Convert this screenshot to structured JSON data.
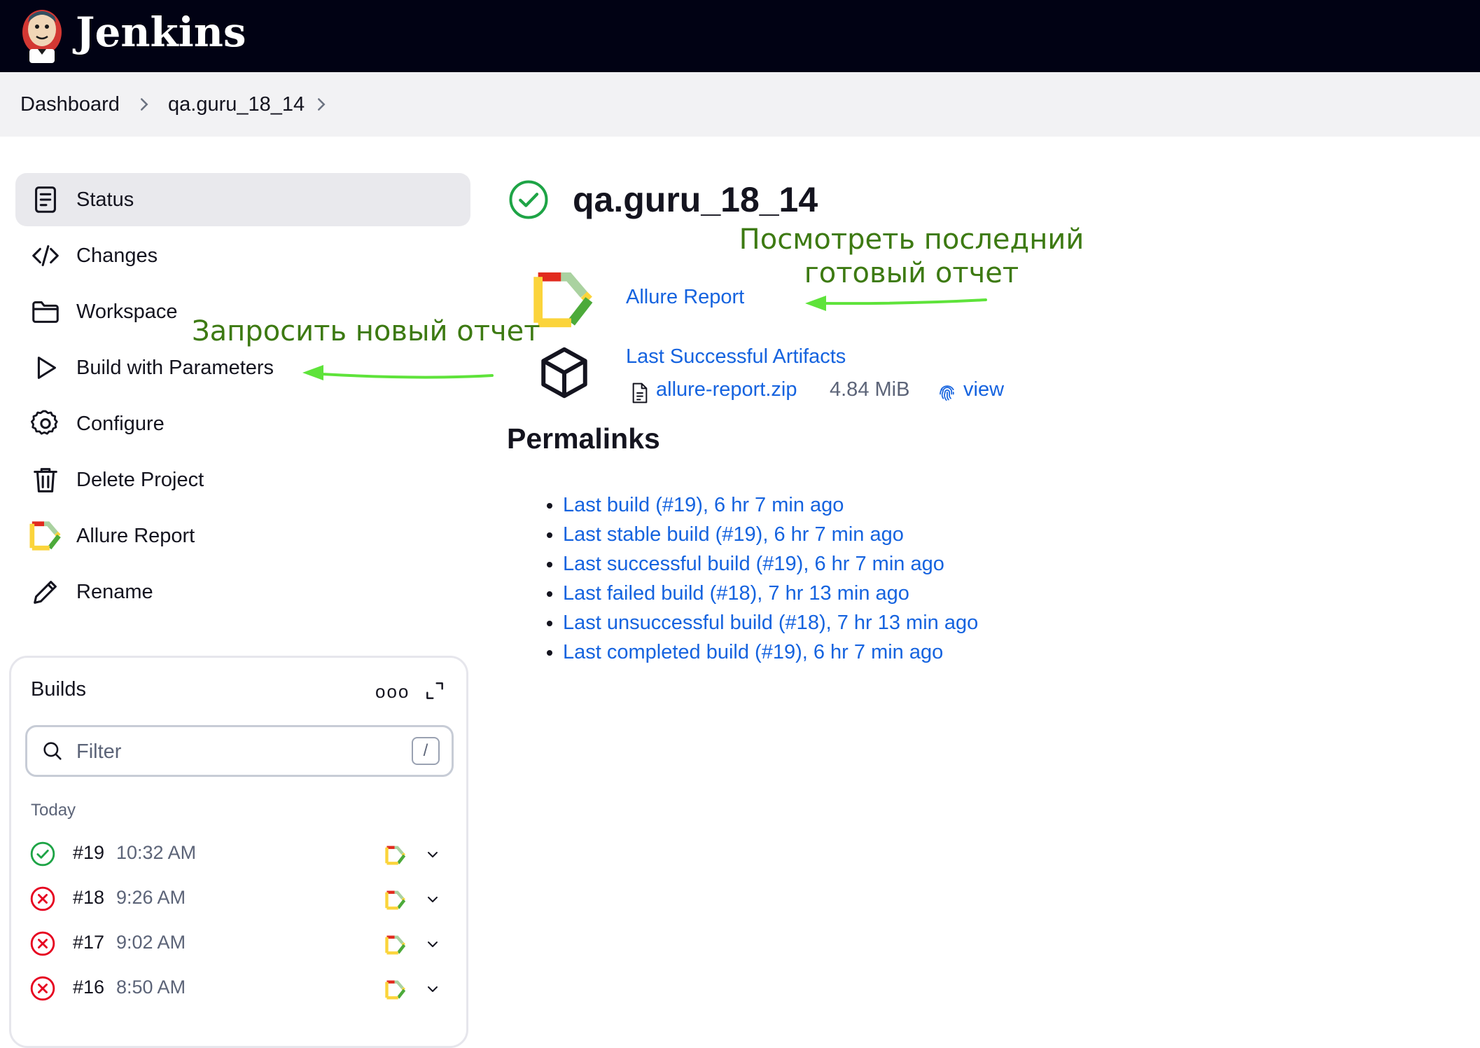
{
  "header": {
    "brand": "Jenkins"
  },
  "breadcrumb": {
    "items": [
      "Dashboard",
      "qa.guru_18_14"
    ]
  },
  "sidebar": {
    "items": [
      {
        "label": "Status",
        "icon": "document-icon",
        "active": true
      },
      {
        "label": "Changes",
        "icon": "code-icon"
      },
      {
        "label": "Workspace",
        "icon": "folder-icon"
      },
      {
        "label": "Build with Parameters",
        "icon": "play-icon"
      },
      {
        "label": "Configure",
        "icon": "gear-icon"
      },
      {
        "label": "Delete Project",
        "icon": "trash-icon"
      },
      {
        "label": "Allure Report",
        "icon": "allure-icon"
      },
      {
        "label": "Rename",
        "icon": "pencil-icon"
      }
    ]
  },
  "builds": {
    "title": "Builds",
    "more": "ooo",
    "filter_placeholder": "Filter",
    "filter_shortcut": "/",
    "group_label": "Today",
    "rows": [
      {
        "number": "#19",
        "time": "10:32 AM",
        "status": "success"
      },
      {
        "number": "#18",
        "time": "9:26 AM",
        "status": "failed"
      },
      {
        "number": "#17",
        "time": "9:02 AM",
        "status": "failed"
      },
      {
        "number": "#16",
        "time": "8:50 AM",
        "status": "failed"
      }
    ]
  },
  "main": {
    "title": "qa.guru_18_14",
    "allure_report_label": "Allure Report",
    "artifacts_label": "Last Successful Artifacts",
    "artifact_file": "allure-report.zip",
    "artifact_size": "4.84 MiB",
    "artifact_view": "view",
    "permalinks_title": "Permalinks",
    "permalinks": [
      "Last build (#19), 6 hr 7 min ago",
      "Last stable build (#19), 6 hr 7 min ago",
      "Last successful build (#19), 6 hr 7 min ago",
      "Last failed build (#18), 7 hr 13 min ago",
      "Last unsuccessful build (#18), 7 hr 13 min ago",
      "Last completed build (#19), 6 hr 7 min ago"
    ]
  },
  "annotations": {
    "latest_report": "Посмотреть последний готовый отчет",
    "request_new": "Запросить новый отчет"
  },
  "colors": {
    "header_bg": "#010214",
    "link": "#1563df",
    "success": "#1ea446",
    "failure": "#e6001f",
    "annotation_text": "#3d7a12",
    "annotation_arrow": "#5ee33a"
  }
}
